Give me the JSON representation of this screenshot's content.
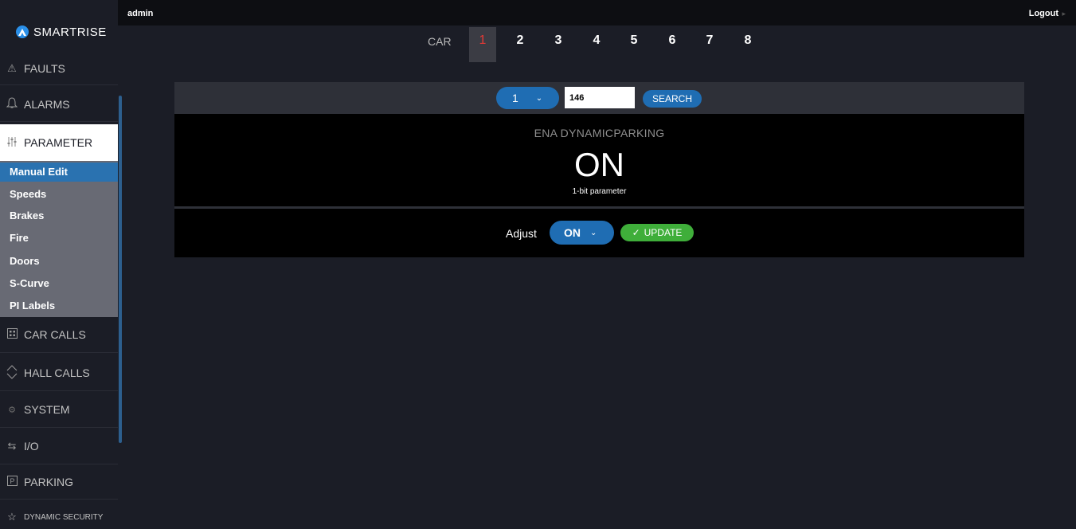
{
  "header": {
    "user": "admin",
    "logout": "Logout"
  },
  "brand": {
    "name": "SMARTRISE"
  },
  "sidebar": {
    "items": [
      {
        "label": "FAULTS",
        "icon": "warning-icon"
      },
      {
        "label": "ALARMS",
        "icon": "bell-icon"
      },
      {
        "label": "PARAMETER",
        "icon": "sliders-icon"
      },
      {
        "label": "CAR CALLS",
        "icon": "keypad-icon"
      },
      {
        "label": "HALL CALLS",
        "icon": "up-down-icon"
      },
      {
        "label": "SYSTEM",
        "icon": "gear-icon"
      },
      {
        "label": "I/O",
        "icon": "swap-icon"
      },
      {
        "label": "PARKING",
        "icon": "parking-icon"
      },
      {
        "label": "DYNAMIC SECURITY",
        "icon": "star-icon"
      }
    ],
    "sub_items": [
      "Manual Edit",
      "Speeds",
      "Brakes",
      "Fire",
      "Doors",
      "S-Curve",
      "PI Labels"
    ],
    "active_item": "PARAMETER",
    "active_sub": "Manual Edit"
  },
  "car_selector": {
    "label": "CAR",
    "cars": [
      "1",
      "2",
      "3",
      "4",
      "5",
      "6",
      "7",
      "8"
    ],
    "selected": "1"
  },
  "search": {
    "select_value": "1",
    "input_value": "146",
    "button_label": "SEARCH"
  },
  "parameter": {
    "name": "ENA DYNAMICPARKING",
    "value": "ON",
    "description": "1-bit parameter"
  },
  "adjust": {
    "label": "Adjust",
    "value": "ON",
    "update_label": "UPDATE"
  },
  "colors": {
    "accent_blue": "#1f6db3",
    "update_green": "#3fae3a",
    "selected_car_red": "#e53935",
    "background": "#1b1d26"
  }
}
